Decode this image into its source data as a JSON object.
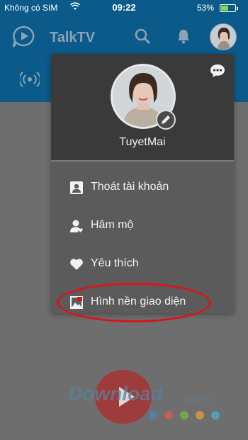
{
  "status_bar": {
    "carrier": "Không có SIM",
    "time": "09:22",
    "battery": "53%",
    "battery_level": 0.53
  },
  "header": {
    "app_title": "TalkTV"
  },
  "profile_menu": {
    "username": "TuyetMai",
    "items": [
      {
        "icon": "account-icon",
        "label": "Thoát tài khoản"
      },
      {
        "icon": "fan-icon",
        "label": "Hâm mộ"
      },
      {
        "icon": "heart-icon",
        "label": "Yêu thích"
      },
      {
        "icon": "wallpaper-icon",
        "label": "Hình nền giao diện"
      }
    ]
  },
  "watermark": {
    "text": "Download",
    "domain": ".com.vn"
  },
  "colors": {
    "header_bg": "#0c5a8a",
    "menu_bg": "#5b5b5b",
    "menu_header_bg": "#3a3a3a",
    "highlight": "#d9141b",
    "record_button": "#9e3b3b"
  }
}
